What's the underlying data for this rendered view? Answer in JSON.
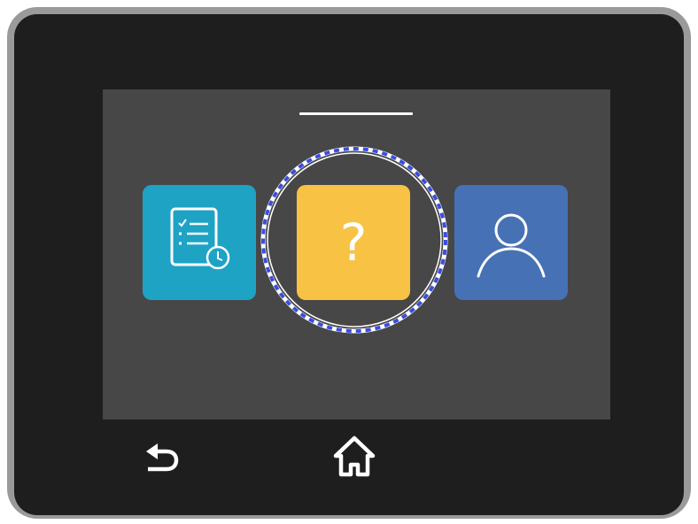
{
  "screen": {
    "page_indicator": "current-page",
    "focused_tile": "help",
    "tiles": [
      {
        "id": "jobs",
        "icon": "job-list-clock-icon",
        "color": "#1ea3c4"
      },
      {
        "id": "help",
        "icon": "question-mark-icon",
        "glyph": "?",
        "color": "#f8c244"
      },
      {
        "id": "account",
        "icon": "user-profile-icon",
        "color": "#4671b4"
      }
    ],
    "focus_ring_color": "#3b4de0"
  },
  "navigation": {
    "back_icon": "back-arrow-icon",
    "home_icon": "home-icon"
  },
  "colors": {
    "screen_background": "#474748",
    "bezel": "#1e1e1e",
    "frame": "#9a9a9a"
  }
}
